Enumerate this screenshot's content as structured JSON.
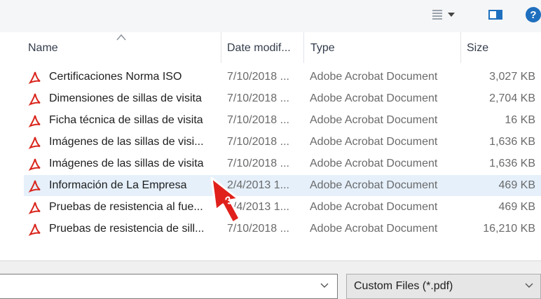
{
  "toolbar": {
    "help_label": "?"
  },
  "columns": {
    "name": "Name",
    "date": "Date modif...",
    "type": "Type",
    "size": "Size"
  },
  "files": [
    {
      "name": "Certificaciones  Norma ISO",
      "date": "7/10/2018 ...",
      "type": "Adobe Acrobat Document",
      "size": "3,027 KB"
    },
    {
      "name": "Dimensiones de sillas de visita",
      "date": "7/10/2018 ...",
      "type": "Adobe Acrobat Document",
      "size": "2,704 KB"
    },
    {
      "name": "Ficha técnica de sillas de visita",
      "date": "7/10/2018 ...",
      "type": "Adobe Acrobat Document",
      "size": "16 KB"
    },
    {
      "name": "Imágenes de las sillas de visi...",
      "date": "7/10/2018 ...",
      "type": "Adobe Acrobat Document",
      "size": "1,636 KB"
    },
    {
      "name": "Imágenes de las sillas de visita",
      "date": "7/10/2018 ...",
      "type": "Adobe Acrobat Document",
      "size": "1,636 KB"
    },
    {
      "name": "Información de La Empresa",
      "date": "2/4/2013 1...",
      "type": "Adobe Acrobat Document",
      "size": "469 KB"
    },
    {
      "name": "Pruebas de resistencia al fue...",
      "date": "2/4/2013 1...",
      "type": "Adobe Acrobat Document",
      "size": "469 KB"
    },
    {
      "name": "Pruebas de resistencia de sill...",
      "date": "7/10/2018 ...",
      "type": "Adobe Acrobat Document",
      "size": "16,210 KB"
    }
  ],
  "cursor": {
    "step": "3"
  },
  "footer": {
    "filename_value": "",
    "filter": "Custom Files (*.pdf)"
  },
  "colors": {
    "accent": "#1f6fbf",
    "selection": "#e5f0fb",
    "pdf_red": "#d9251c",
    "cursor_red": "#e0201b"
  }
}
